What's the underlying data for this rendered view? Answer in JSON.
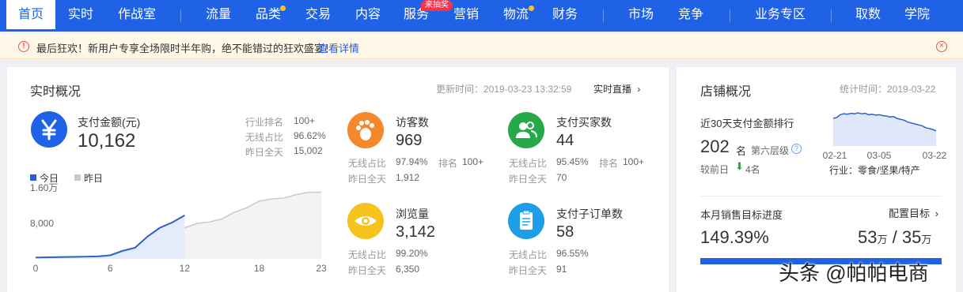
{
  "nav": {
    "items": [
      "首页",
      "实时",
      "作战室",
      "流量",
      "品类",
      "交易",
      "内容",
      "服务",
      "营销",
      "物流",
      "财务",
      "市场",
      "竞争",
      "业务专区",
      "取数",
      "学院"
    ],
    "active": "首页",
    "badge": "来抽奖"
  },
  "notice": {
    "text": "最后狂欢！新用户专享全场限时半年购，绝不能错过的狂欢盛宴！",
    "link": "查看详情"
  },
  "realtime": {
    "title": "实时概况",
    "update_time": "更新时间：2019-03-23 13:32:59",
    "live_link": "实时直播",
    "pay_amount": {
      "label": "支付金额(元)",
      "value": "10,162",
      "stats": [
        {
          "label": "行业排名",
          "value": "100+"
        },
        {
          "label": "无线占比",
          "value": "96.62%"
        },
        {
          "label": "昨日全天",
          "value": "15,002"
        }
      ]
    },
    "visitors": {
      "label": "访客数",
      "value": "969",
      "wireless_label": "无线占比",
      "wireless": "97.94%",
      "rank_label": "排名",
      "rank": "100+",
      "yesterday_label": "昨日全天",
      "yesterday": "1,912"
    },
    "buyers": {
      "label": "支付买家数",
      "value": "44",
      "wireless_label": "无线占比",
      "wireless": "95.45%",
      "rank_label": "排名",
      "rank": "100+",
      "yesterday_label": "昨日全天",
      "yesterday": "70"
    },
    "pageviews": {
      "label": "浏览量",
      "value": "3,142",
      "wireless_label": "无线占比",
      "wireless": "99.20%",
      "yesterday_label": "昨日全天",
      "yesterday": "6,350"
    },
    "suborders": {
      "label": "支付子订单数",
      "value": "58",
      "wireless_label": "无线占比",
      "wireless": "96.55%",
      "yesterday_label": "昨日全天",
      "yesterday": "91"
    }
  },
  "chart_data": [
    {
      "type": "area",
      "legend": [
        "今日",
        "昨日"
      ],
      "x_ticks": [
        "0",
        "6",
        "12",
        "18",
        "23"
      ],
      "y_ticks": [
        "1.60万",
        "8,000"
      ],
      "ylim": [
        0,
        16000
      ],
      "xlim": [
        0,
        23
      ],
      "series": [
        {
          "name": "今日",
          "color": "#2a5fd0",
          "x": [
            0,
            1,
            2,
            3,
            4,
            5,
            6,
            7,
            8,
            9,
            10,
            11,
            12
          ],
          "values": [
            300,
            350,
            400,
            450,
            500,
            550,
            800,
            1800,
            2500,
            5000,
            7000,
            8200,
            9800
          ]
        },
        {
          "name": "昨日",
          "color": "#c9c9c9",
          "x": [
            0,
            1,
            2,
            3,
            4,
            5,
            6,
            7,
            8,
            9,
            10,
            11,
            12,
            13,
            14,
            15,
            16,
            17,
            18,
            19,
            20,
            21,
            22,
            23
          ],
          "values": [
            300,
            320,
            350,
            400,
            450,
            500,
            700,
            1500,
            1800,
            3000,
            4500,
            5000,
            7000,
            8000,
            8300,
            9000,
            10500,
            11500,
            13000,
            13500,
            13700,
            14500,
            15000,
            15000
          ]
        }
      ]
    },
    {
      "type": "area",
      "x_ticks": [
        "02-21",
        "03-05",
        "03-22"
      ],
      "series": [
        {
          "name": "支付金额排行",
          "color": "#2a5fd0",
          "values": [
            60,
            62,
            68,
            70,
            69,
            71,
            70,
            72,
            70,
            71,
            68,
            69,
            67,
            68,
            66,
            65,
            63,
            64,
            60,
            58,
            56,
            52,
            50,
            48,
            46,
            44,
            40,
            38,
            36,
            33
          ]
        }
      ]
    }
  ],
  "shop": {
    "title": "店铺概况",
    "stat_time": "统计时间：2019-03-22",
    "rank_title": "近30天支付金额排行",
    "rank_value": "202",
    "rank_unit": "名",
    "level": "第六层级",
    "compare_label": "较前日",
    "compare_value": "4名",
    "industry": "行业：零食/坚果/特产",
    "goal_title": "本月销售目标进度",
    "goal_link": "配置目标",
    "goal_percent": "149.39%",
    "goal_progress": 1.0,
    "goal_actual": "53",
    "goal_actual_unit": "万",
    "goal_sep": "/",
    "goal_target": "35",
    "goal_target_unit": "万"
  },
  "watermark": "头条 @帕帕电商",
  "colors": {
    "primary": "#2062e6",
    "orange": "#f5872c",
    "green": "#27a94a",
    "yellow": "#f6c21c",
    "sky": "#1e9ee8",
    "up_green": "#27a94a"
  }
}
